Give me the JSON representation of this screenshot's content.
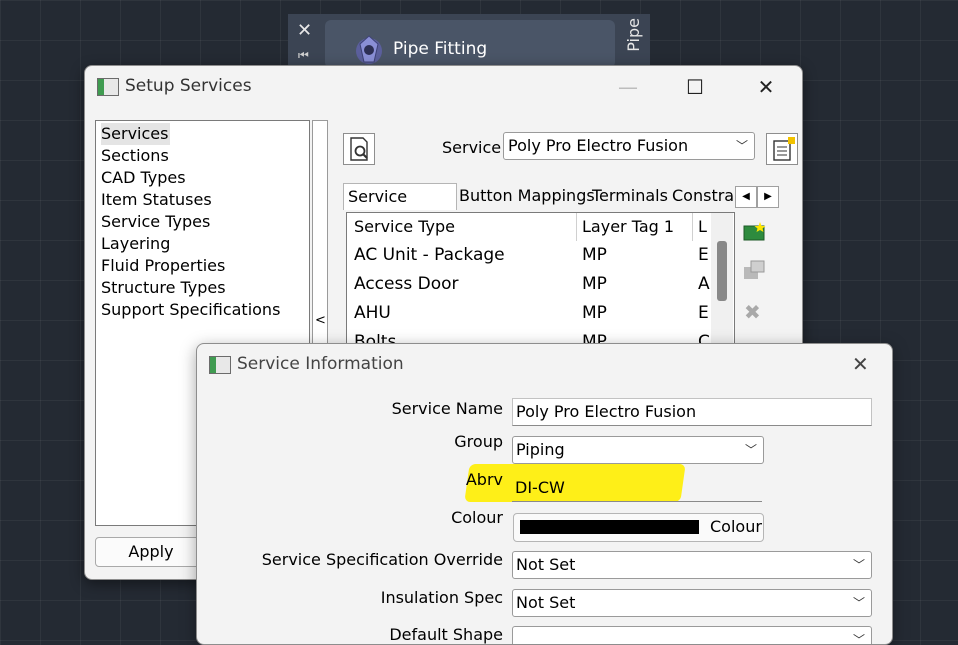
{
  "palette": {
    "title": "Pipe Fitting",
    "side_tab": "Pipe"
  },
  "setup": {
    "title": "Setup Services",
    "nav_items": [
      "Services",
      "Sections",
      "CAD Types",
      "Item Statuses",
      "Service Types",
      "Layering",
      "Fluid Properties",
      "Structure Types",
      "Support Specifications"
    ],
    "collapse_glyph": "<",
    "apply_label": "Apply",
    "service_label": "Service",
    "service_value": "Poly Pro Electro Fusion",
    "tabs": [
      "Service Types",
      "Button Mappings",
      "Terminals",
      "Constrai"
    ],
    "grid": {
      "headers": [
        "Service Type",
        "Layer Tag 1",
        "L"
      ],
      "rows": [
        [
          "AC Unit - Package",
          "MP",
          "E"
        ],
        [
          "Access Door",
          "MP",
          "A"
        ],
        [
          "AHU",
          "MP",
          "E"
        ],
        [
          "Bolts",
          "MP",
          "C"
        ]
      ]
    }
  },
  "info": {
    "title": "Service Information",
    "labels": {
      "service_name": "Service Name",
      "group": "Group",
      "abrv": "Abrv",
      "colour": "Colour",
      "spec_override": "Service Specification Override",
      "insulation": "Insulation Spec",
      "default_shape": "Default Shape"
    },
    "values": {
      "service_name": "Poly Pro Electro Fusion",
      "group": "Piping",
      "abrv": "DI-CW",
      "colour_button": "Colour",
      "colour_hex": "#000000",
      "spec_override": "Not Set",
      "insulation": "Not Set",
      "default_shape": ""
    },
    "highlight_color": "#ffee00"
  }
}
